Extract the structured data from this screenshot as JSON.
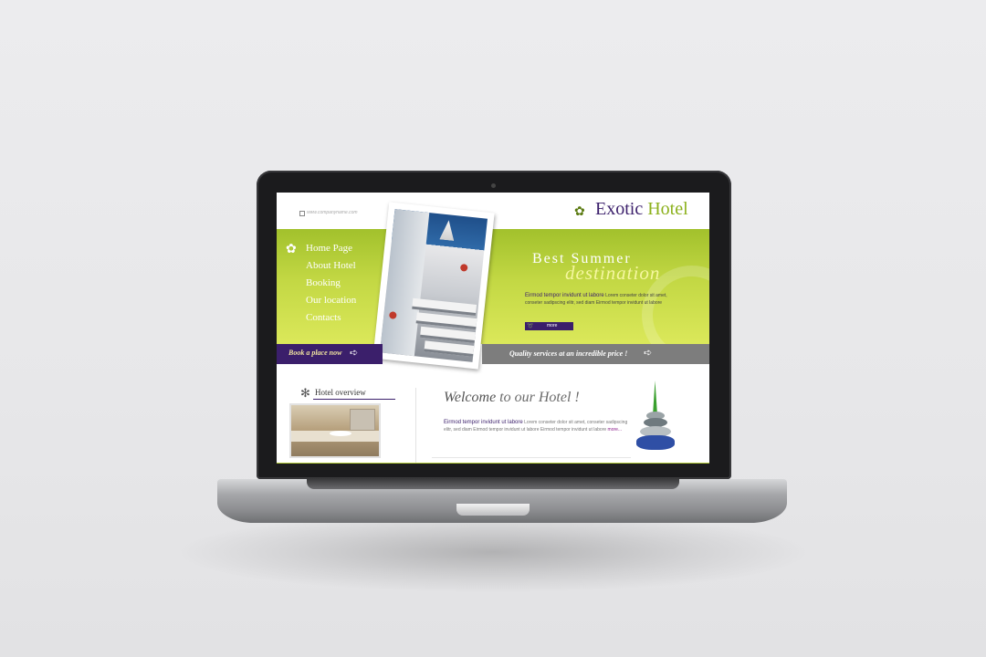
{
  "site": {
    "url_text": "www.companyname.com",
    "logo_word1": "Exotic",
    "logo_word2": "Hotel"
  },
  "nav": {
    "items": [
      {
        "label": "Home Page"
      },
      {
        "label": "About Hotel"
      },
      {
        "label": "Booking"
      },
      {
        "label": "Our location"
      },
      {
        "label": "Contacts"
      }
    ]
  },
  "hero": {
    "title_line1": "Best Summer",
    "title_line2": "destination",
    "lead": "Eirmod tempor invidunt ut labore",
    "text": "Lorem conseter dolor sit amet, conseter sadipscing elitr, sed diam Eirmod tempor invidunt ut labore",
    "more_label": "more"
  },
  "bars": {
    "book_label": "Book a place now",
    "quality_label": "Quality services at an incredible price !"
  },
  "overview": {
    "title": "Hotel overview"
  },
  "welcome": {
    "title_a": "Welcome",
    "title_b": " to our Hotel !",
    "lead": "Eirmod tempor invidunt ut labore",
    "text": " Lorem conseter dolor sit amet, conseter sadipscing elitr, sed diam Eirmod tempor invidunt ut labore Eirmod tempor invidunt ut labore ",
    "more_label": "more..."
  },
  "colors": {
    "brand_purple": "#3b1f6b",
    "brand_green": "#a2c12c",
    "bar_gray": "#7d7d7d"
  }
}
